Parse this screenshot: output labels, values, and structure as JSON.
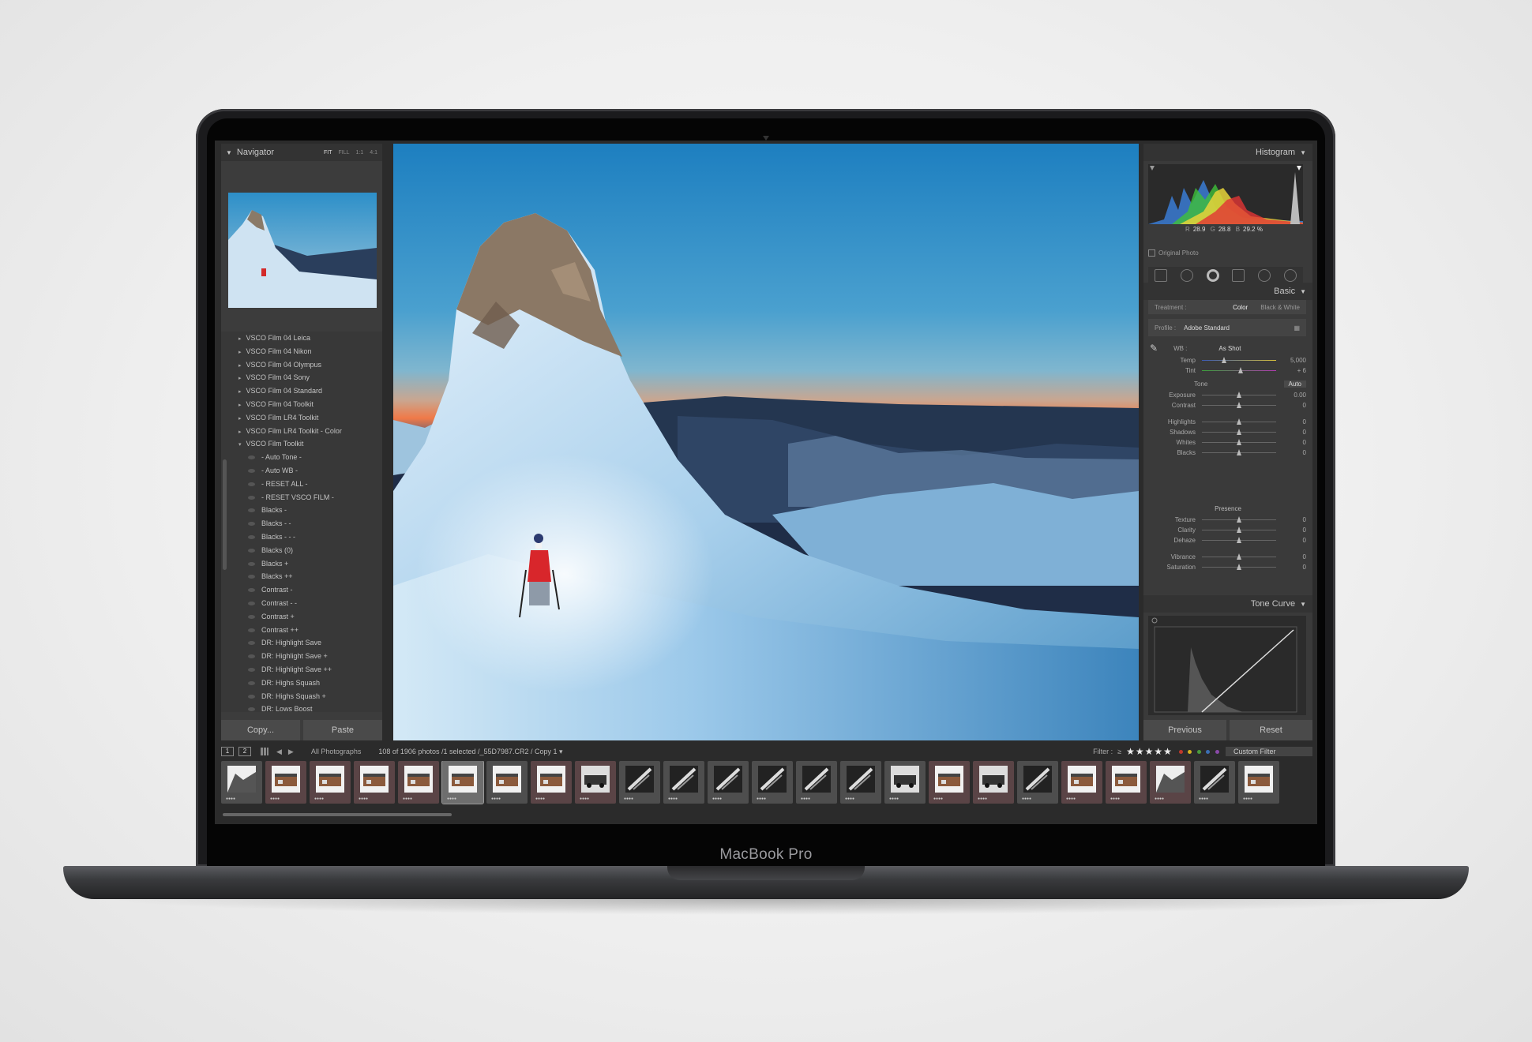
{
  "device": {
    "brand": "MacBook Pro"
  },
  "navigator": {
    "title": "Navigator",
    "zoom": [
      "FIT",
      "FILL",
      "1:1",
      "4:1"
    ]
  },
  "presets": [
    {
      "label": "VSCO Film 04 Leica",
      "kind": "folder"
    },
    {
      "label": "VSCO Film 04 Nikon",
      "kind": "folder"
    },
    {
      "label": "VSCO Film 04 Olympus",
      "kind": "folder"
    },
    {
      "label": "VSCO Film 04 Sony",
      "kind": "folder"
    },
    {
      "label": "VSCO Film 04 Standard",
      "kind": "folder"
    },
    {
      "label": "VSCO Film 04 Toolkit",
      "kind": "folder"
    },
    {
      "label": "VSCO Film LR4 Toolkit",
      "kind": "folder"
    },
    {
      "label": "VSCO Film LR4 Toolkit - Color",
      "kind": "folder"
    },
    {
      "label": "VSCO Film Toolkit",
      "kind": "folder-open"
    },
    {
      "label": "- Auto Tone -",
      "kind": "item"
    },
    {
      "label": "- Auto WB -",
      "kind": "item"
    },
    {
      "label": "- RESET ALL -",
      "kind": "item"
    },
    {
      "label": "- RESET VSCO FILM -",
      "kind": "item"
    },
    {
      "label": "Blacks -",
      "kind": "item"
    },
    {
      "label": "Blacks - -",
      "kind": "item"
    },
    {
      "label": "Blacks - - -",
      "kind": "item"
    },
    {
      "label": "Blacks (0)",
      "kind": "item"
    },
    {
      "label": "Blacks +",
      "kind": "item"
    },
    {
      "label": "Blacks ++",
      "kind": "item"
    },
    {
      "label": "Contrast -",
      "kind": "item"
    },
    {
      "label": "Contrast - -",
      "kind": "item"
    },
    {
      "label": "Contrast +",
      "kind": "item"
    },
    {
      "label": "Contrast ++",
      "kind": "item"
    },
    {
      "label": "DR: Highlight Save",
      "kind": "item"
    },
    {
      "label": "DR: Highlight Save +",
      "kind": "item"
    },
    {
      "label": "DR: Highlight Save ++",
      "kind": "item"
    },
    {
      "label": "DR: Highs Squash",
      "kind": "item"
    },
    {
      "label": "DR: Highs Squash +",
      "kind": "item"
    },
    {
      "label": "DR: Lows Boost",
      "kind": "item"
    }
  ],
  "left_buttons": {
    "copy": "Copy...",
    "paste": "Paste"
  },
  "histogram": {
    "title": "Histogram",
    "r_label": "R",
    "r_value": "28.9",
    "g_label": "G",
    "g_value": "28.8",
    "b_label": "B",
    "b_value": "29.2 %",
    "original_photo": "Original Photo"
  },
  "basic": {
    "title": "Basic",
    "treatment_label": "Treatment :",
    "treatment_color": "Color",
    "treatment_bw": "Black & White",
    "profile_label": "Profile :",
    "profile_value": "Adobe Standard",
    "wb_label": "WB :",
    "wb_value": "As Shot",
    "temp_label": "Temp",
    "temp_value": "5,000",
    "tint_label": "Tint",
    "tint_value": "+ 6",
    "tone_label": "Tone",
    "auto_label": "Auto",
    "tone_sliders": [
      {
        "label": "Exposure",
        "value": "0.00"
      },
      {
        "label": "Contrast",
        "value": "0"
      }
    ],
    "tone_sliders2": [
      {
        "label": "Highlights",
        "value": "0"
      },
      {
        "label": "Shadows",
        "value": "0"
      },
      {
        "label": "Whites",
        "value": "0"
      },
      {
        "label": "Blacks",
        "value": "0"
      }
    ],
    "presence_label": "Presence",
    "presence_sliders": [
      {
        "label": "Texture",
        "value": "0"
      },
      {
        "label": "Clarity",
        "value": "0"
      },
      {
        "label": "Dehaze",
        "value": "0"
      }
    ],
    "presence_sliders2": [
      {
        "label": "Vibrance",
        "value": "0"
      },
      {
        "label": "Saturation",
        "value": "0"
      }
    ]
  },
  "tone_curve": {
    "title": "Tone Curve"
  },
  "right_buttons": {
    "previous": "Previous",
    "reset": "Reset"
  },
  "filmstrip_bar": {
    "screen1": "1",
    "screen2": "2",
    "source": "All Photographs",
    "info": "108 of 1906 photos /1 selected /_55D7987.CR2 / Copy 1 ▾",
    "filter_label": "Filter :",
    "filter_rating": "≥",
    "stars": "★★★★★",
    "custom_filter": "Custom Filter"
  },
  "colors": {
    "lr_panel": "#3a3a3a",
    "lr_bg": "#2b2b2b",
    "label_red": "#c0392b",
    "label_yellow": "#d4b320",
    "label_green": "#4a9a3c",
    "label_blue": "#3c6fb4",
    "label_purple": "#8a49a8"
  }
}
